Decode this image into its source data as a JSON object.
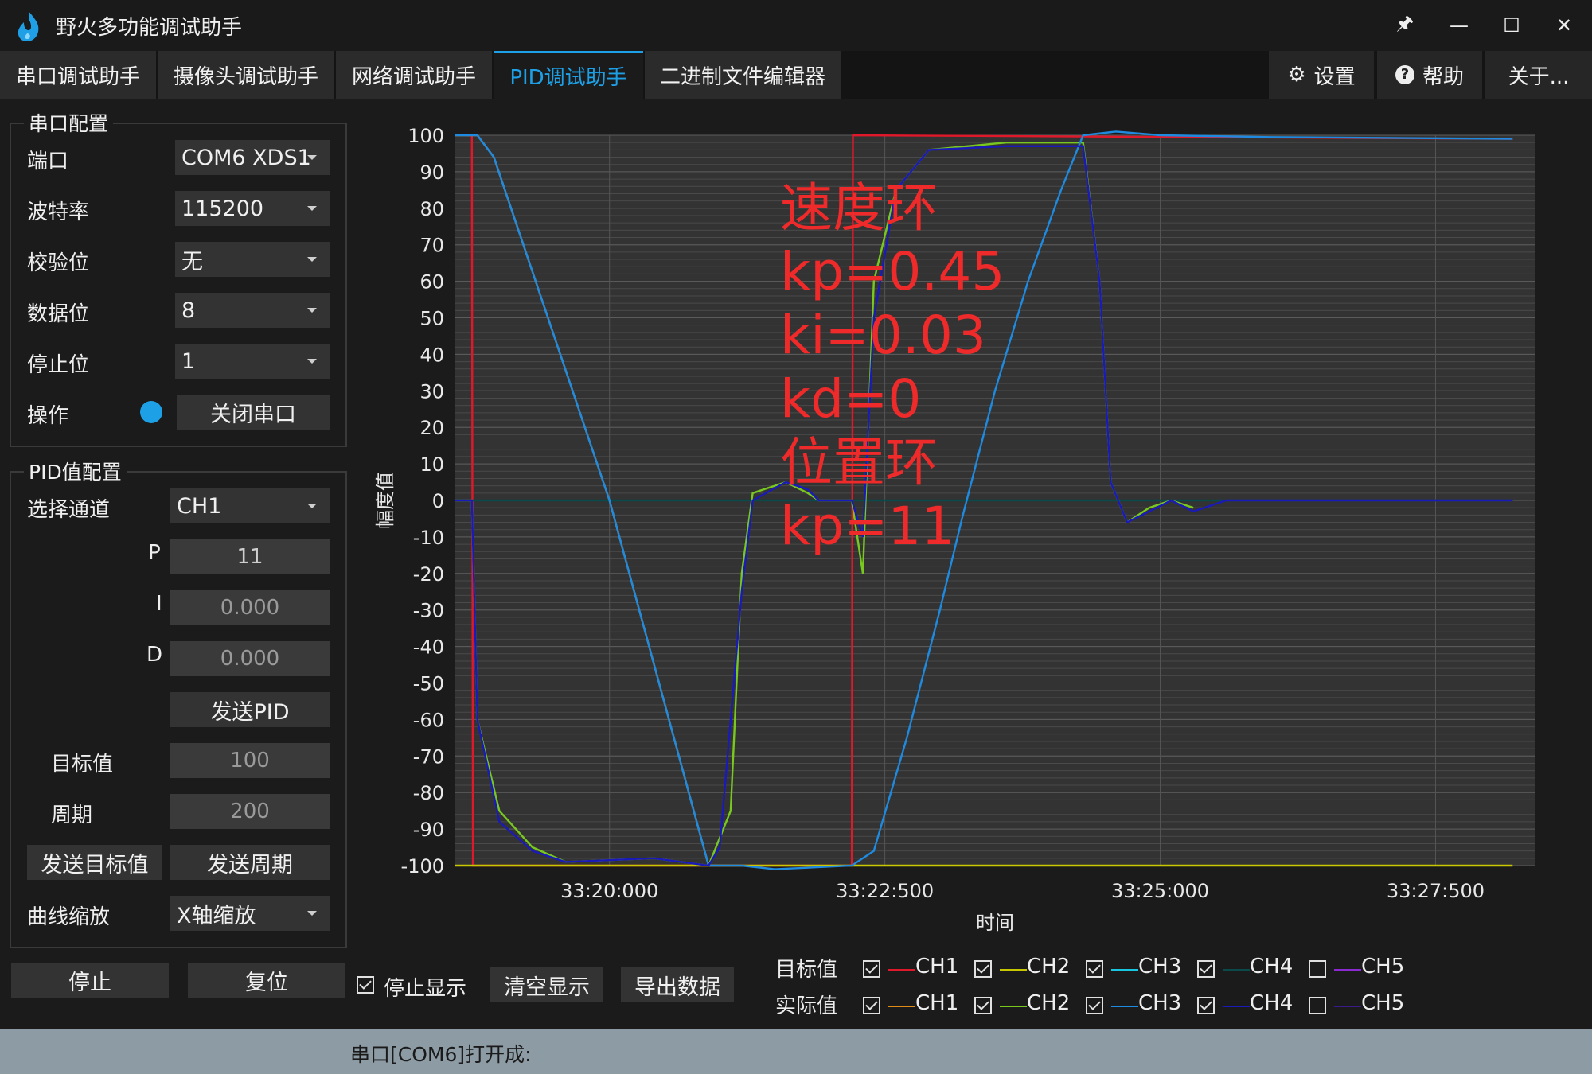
{
  "window": {
    "title": "野火多功能调试助手",
    "controls": {
      "pin": "🖈",
      "minimize": "—",
      "maximize": "☐",
      "close": "✕"
    }
  },
  "tabs": [
    {
      "label": "串口调试助手"
    },
    {
      "label": "摄像头调试助手"
    },
    {
      "label": "网络调试助手"
    },
    {
      "label": "PID调试助手"
    },
    {
      "label": "二进制文件编辑器"
    }
  ],
  "active_tab": "PID调试助手",
  "right_tabs": {
    "settings": "设置",
    "help": "帮助",
    "about": "关于..."
  },
  "serial_config": {
    "title": "串口配置",
    "port_label": "端口",
    "port_value": "COM6 XDS1",
    "baud_label": "波特率",
    "baud_value": "115200",
    "parity_label": "校验位",
    "parity_value": "无",
    "databits_label": "数据位",
    "databits_value": "8",
    "stopbits_label": "停止位",
    "stopbits_value": "1",
    "op_label": "操作",
    "op_button": "关闭串口"
  },
  "pid_config": {
    "title": "PID值配置",
    "channel_label": "选择通道",
    "channel_value": "CH1",
    "p_label": "P",
    "p_value": "11",
    "i_label": "I",
    "i_value": "0.000",
    "d_label": "D",
    "d_value": "0.000",
    "send_pid": "发送PID",
    "target_label": "目标值",
    "target_value": "100",
    "period_label": "周期",
    "period_value": "200",
    "send_target": "发送目标值",
    "send_period": "发送周期",
    "zoom_label": "曲线缩放",
    "zoom_value": "X轴缩放"
  },
  "bottom_controls": {
    "stop": "停止",
    "reset": "复位",
    "stop_display": "停止显示",
    "stop_display_checked": true,
    "clear": "清空显示",
    "export": "导出数据"
  },
  "legend": {
    "target_label": "目标值",
    "actual_label": "实际值",
    "target": [
      {
        "name": "CH1",
        "checked": true,
        "color": "#e0182a"
      },
      {
        "name": "CH2",
        "checked": true,
        "color": "#c8c800"
      },
      {
        "name": "CH3",
        "checked": true,
        "color": "#19c8e0"
      },
      {
        "name": "CH4",
        "checked": true,
        "color": "#0a4a4a"
      },
      {
        "name": "CH5",
        "checked": false,
        "color": "#8a2ad0"
      }
    ],
    "actual": [
      {
        "name": "CH1",
        "checked": true,
        "color": "#e08a18"
      },
      {
        "name": "CH2",
        "checked": true,
        "color": "#78c820"
      },
      {
        "name": "CH3",
        "checked": true,
        "color": "#1e8ae0"
      },
      {
        "name": "CH4",
        "checked": true,
        "color": "#1a1ab8"
      },
      {
        "name": "CH5",
        "checked": false,
        "color": "#3a1a8a"
      }
    ]
  },
  "annotation": {
    "line1": "速度环",
    "line2": "kp=0.45",
    "line3": "ki=0.03",
    "line4": "kd=0",
    "line5": "位置环",
    "line6": "kp=11"
  },
  "status": {
    "text": "串口[COM6]打开成:"
  },
  "chart_data": {
    "type": "line",
    "ylabel": "幅度值",
    "xlabel": "时间",
    "ylim": [
      -100,
      100
    ],
    "yticks": [
      100,
      90,
      80,
      70,
      60,
      50,
      40,
      30,
      20,
      10,
      0,
      -10,
      -20,
      -30,
      -40,
      -50,
      -60,
      -70,
      -80,
      -90,
      -100
    ],
    "xticks": [
      "33:20:000",
      "33:22:500",
      "33:25:000",
      "33:27:500"
    ],
    "xlim_seconds": [
      1198.6,
      1208.4
    ],
    "grid": true,
    "series": [
      {
        "name": "目标值 CH1",
        "color": "#e0182a",
        "points": [
          [
            1198.7,
            100
          ],
          [
            1198.75,
            100
          ],
          [
            1198.76,
            -100
          ],
          [
            1202.2,
            -100
          ],
          [
            1202.21,
            100
          ],
          [
            1208.2,
            99
          ]
        ]
      },
      {
        "name": "目标值 CH2",
        "color": "#c8c800",
        "points": [
          [
            1198.6,
            -100
          ],
          [
            1208.2,
            -100
          ]
        ]
      },
      {
        "name": "目标值 CH4",
        "color": "#0a4a4a",
        "points": [
          [
            1198.6,
            0
          ],
          [
            1208.2,
            0
          ]
        ]
      },
      {
        "name": "实际值 CH1",
        "color": "#e08a18",
        "points": [
          [
            1198.6,
            100
          ],
          [
            1198.8,
            100
          ],
          [
            1198.95,
            94
          ],
          [
            1200.0,
            0
          ],
          [
            1200.9,
            -100
          ],
          [
            1201.2,
            -100
          ]
        ]
      },
      {
        "name": "实际值 CH2",
        "color": "#78c820",
        "points": [
          [
            1198.6,
            0
          ],
          [
            1198.75,
            0
          ],
          [
            1198.8,
            -60
          ],
          [
            1199.0,
            -85
          ],
          [
            1199.3,
            -95
          ],
          [
            1199.6,
            -99
          ],
          [
            1200.4,
            -98
          ],
          [
            1200.9,
            -100
          ],
          [
            1201.1,
            -85
          ],
          [
            1201.2,
            -20
          ],
          [
            1201.3,
            2
          ],
          [
            1201.6,
            5
          ],
          [
            1201.8,
            2
          ],
          [
            1201.9,
            0
          ],
          [
            1202.2,
            0
          ],
          [
            1202.3,
            -20
          ],
          [
            1202.4,
            60
          ],
          [
            1202.6,
            85
          ],
          [
            1202.9,
            96
          ],
          [
            1203.6,
            98
          ],
          [
            1204.3,
            98
          ],
          [
            1204.45,
            60
          ],
          [
            1204.55,
            5
          ],
          [
            1204.7,
            -6
          ],
          [
            1204.9,
            -2
          ],
          [
            1205.1,
            0
          ],
          [
            1205.3,
            -2
          ]
        ]
      },
      {
        "name": "实际值 CH3",
        "color": "#1e8ae0",
        "points": [
          [
            1198.6,
            100
          ],
          [
            1198.8,
            100
          ],
          [
            1198.95,
            94
          ],
          [
            1200.0,
            0
          ],
          [
            1200.9,
            -100
          ],
          [
            1201.2,
            -100
          ],
          [
            1201.5,
            -101
          ],
          [
            1202.2,
            -100
          ],
          [
            1202.4,
            -96
          ],
          [
            1202.7,
            -65
          ],
          [
            1203.0,
            -30
          ],
          [
            1203.2,
            -5
          ],
          [
            1203.5,
            30
          ],
          [
            1203.8,
            60
          ],
          [
            1204.1,
            85
          ],
          [
            1204.3,
            100
          ],
          [
            1204.6,
            101
          ],
          [
            1205.0,
            100
          ],
          [
            1206.0,
            99.5
          ],
          [
            1208.2,
            99
          ]
        ]
      },
      {
        "name": "实际值 CH4",
        "color": "#1a1ab8",
        "points": [
          [
            1198.6,
            0
          ],
          [
            1198.75,
            0
          ],
          [
            1198.8,
            -60
          ],
          [
            1199.0,
            -88
          ],
          [
            1199.3,
            -96
          ],
          [
            1199.6,
            -99
          ],
          [
            1200.4,
            -98
          ],
          [
            1200.9,
            -100
          ],
          [
            1201.0,
            -95
          ],
          [
            1201.2,
            -25
          ],
          [
            1201.3,
            0
          ],
          [
            1201.6,
            5
          ],
          [
            1201.8,
            3
          ],
          [
            1201.9,
            0
          ],
          [
            1202.2,
            0
          ],
          [
            1202.3,
            -10
          ],
          [
            1202.4,
            50
          ],
          [
            1202.6,
            85
          ],
          [
            1202.9,
            96
          ],
          [
            1203.6,
            97
          ],
          [
            1204.3,
            97
          ],
          [
            1204.45,
            60
          ],
          [
            1204.55,
            5
          ],
          [
            1204.7,
            -6
          ],
          [
            1204.9,
            -3
          ],
          [
            1205.1,
            0
          ],
          [
            1205.3,
            -3
          ],
          [
            1205.6,
            0
          ],
          [
            1208.2,
            0
          ]
        ]
      }
    ]
  }
}
